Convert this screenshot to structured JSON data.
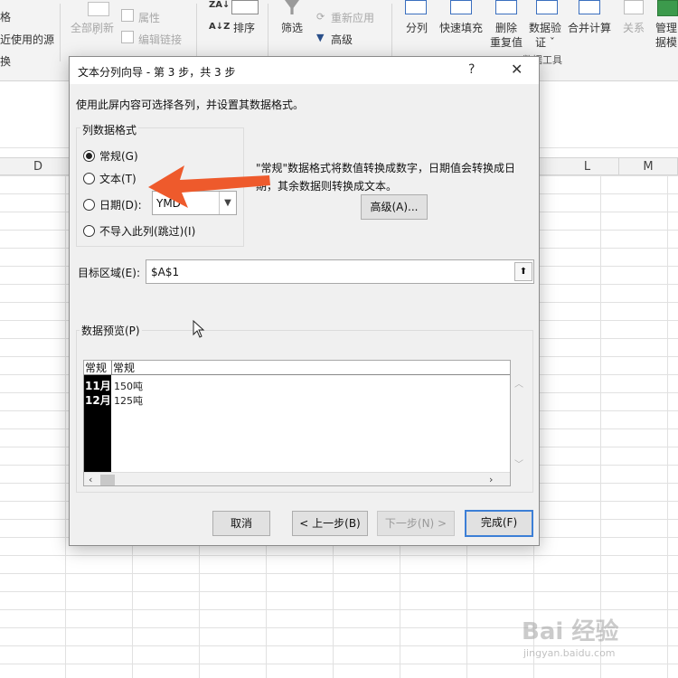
{
  "ribbon": {
    "left_items": [
      "格",
      "近使用的源",
      "换"
    ],
    "refresh_label": "全部刷新",
    "properties_label": "属性",
    "edit_links_label": "编辑链接",
    "sort_label": "排序",
    "filter_label": "筛选",
    "reapply_label": "重新应用",
    "advanced_label": "高级",
    "split_label": "分列",
    "flash_fill_label": "快速填充",
    "remove_dup_label": [
      "删除",
      "重复值"
    ],
    "validation_label": [
      "数据验",
      "证 ˇ"
    ],
    "consolidate_label": "合并计算",
    "relations_label": "关系",
    "manage_label": [
      "管理",
      "据模"
    ],
    "group_label": "数据工具"
  },
  "columns": [
    "D",
    "L",
    "M"
  ],
  "dialog": {
    "title": "文本分列向导 - 第 3 步，共 3 步",
    "help": "?",
    "close": "✕",
    "instruction": "使用此屏内容可选择各列，并设置其数据格式。",
    "format_group_label": "列数据格式",
    "options": [
      {
        "label": "常规(G)",
        "checked": true
      },
      {
        "label": "文本(T)",
        "checked": false
      },
      {
        "label": "日期(D):",
        "checked": false
      },
      {
        "label": "不导入此列(跳过)(I)",
        "checked": false
      }
    ],
    "date_format": "YMD",
    "description": "\"常规\"数据格式将数值转换成数字，日期值会转换成日期，其余数据则转换成文本。",
    "advanced_button": "高级(A)...",
    "target_label": "目标区域(E):",
    "target_value": "$A$1",
    "preview_label": "数据预览(P)",
    "preview_headers": [
      "常规",
      "常规"
    ],
    "preview_rows": [
      [
        "11月",
        "150吨"
      ],
      [
        "12月",
        "125吨"
      ]
    ],
    "buttons": {
      "cancel": "取消",
      "back": "< 上一步(B)",
      "next": "下一步(N) >",
      "finish": "完成(F)"
    }
  },
  "watermark": {
    "text": "Bai 经验",
    "sub": "jingyan.baidu.com"
  },
  "colors": {
    "arrow": "#ee5a2c",
    "focus_border": "#3c7fd6"
  }
}
